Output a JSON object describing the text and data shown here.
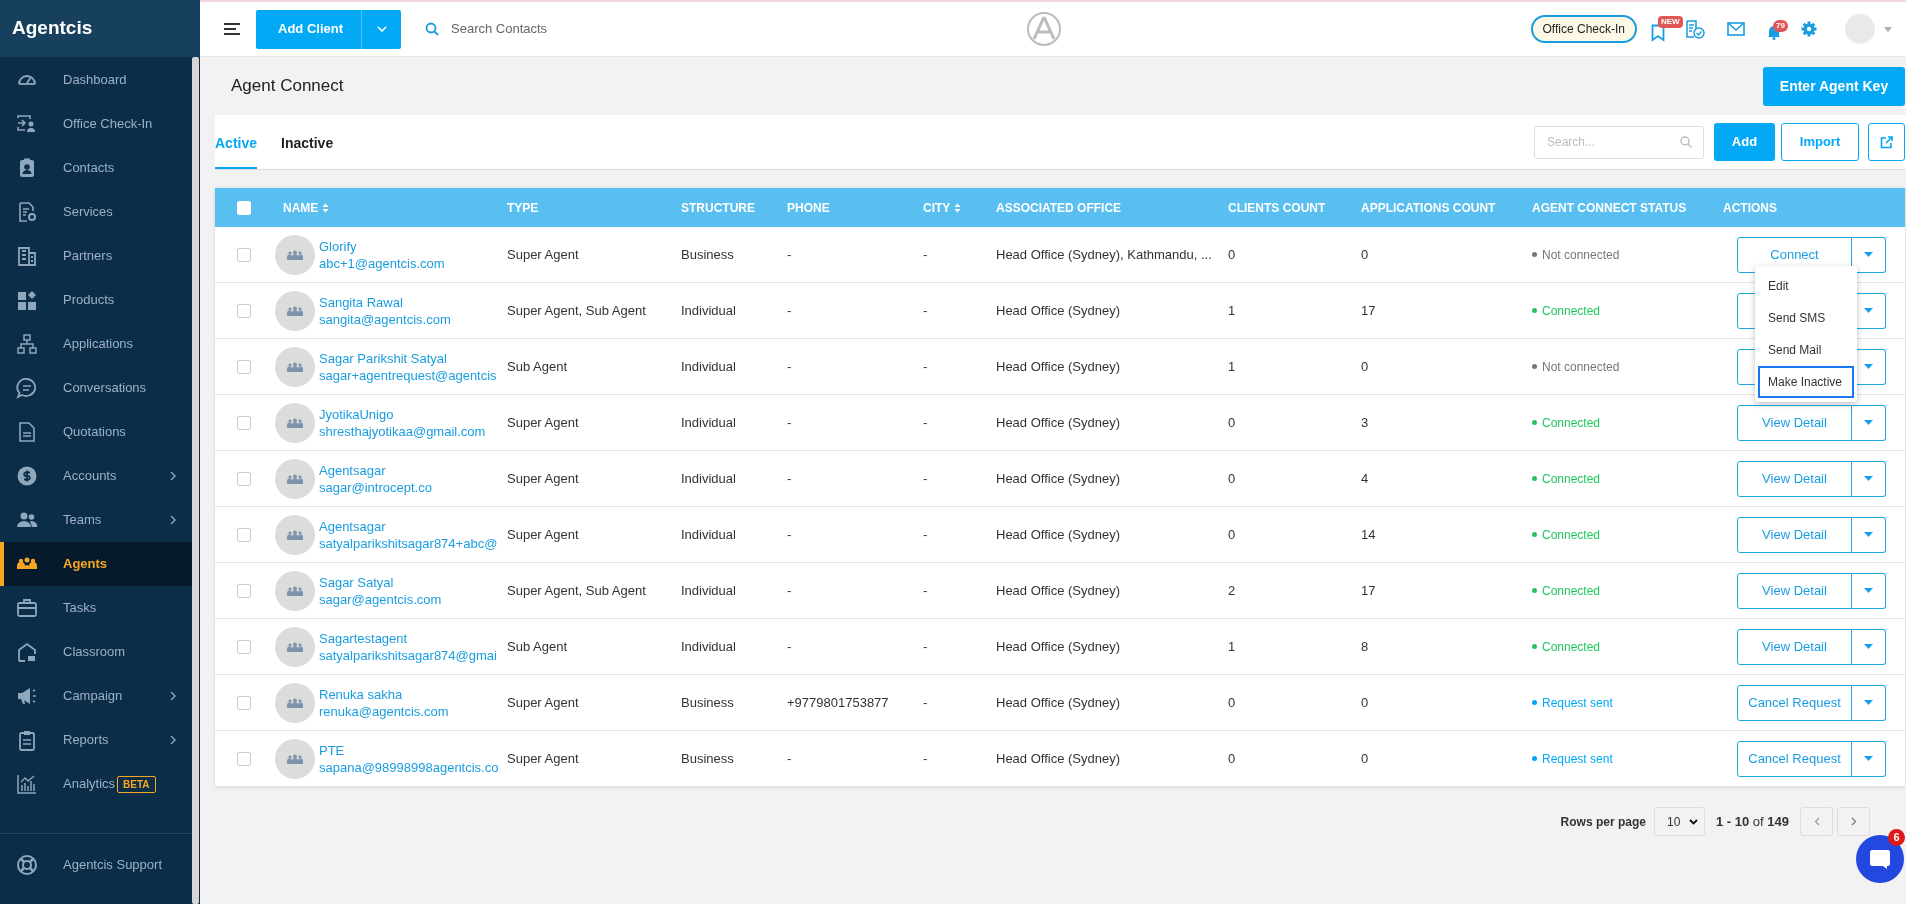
{
  "sidebar": {
    "brand": "Agentcis",
    "items": [
      {
        "label": "Dashboard",
        "submenu": false,
        "selected": false
      },
      {
        "label": "Office Check-In",
        "submenu": false,
        "selected": false
      },
      {
        "label": "Contacts",
        "submenu": false,
        "selected": false
      },
      {
        "label": "Services",
        "submenu": false,
        "selected": false
      },
      {
        "label": "Partners",
        "submenu": false,
        "selected": false
      },
      {
        "label": "Products",
        "submenu": false,
        "selected": false
      },
      {
        "label": "Applications",
        "submenu": false,
        "selected": false
      },
      {
        "label": "Conversations",
        "submenu": false,
        "selected": false
      },
      {
        "label": "Quotations",
        "submenu": false,
        "selected": false
      },
      {
        "label": "Accounts",
        "submenu": true,
        "selected": false
      },
      {
        "label": "Teams",
        "submenu": true,
        "selected": false
      },
      {
        "label": "Agents",
        "submenu": false,
        "selected": true
      },
      {
        "label": "Tasks",
        "submenu": false,
        "selected": false
      },
      {
        "label": "Classroom",
        "submenu": false,
        "selected": false
      },
      {
        "label": "Campaign",
        "submenu": true,
        "selected": false
      },
      {
        "label": "Reports",
        "submenu": true,
        "selected": false
      },
      {
        "label": "Analytics",
        "submenu": false,
        "selected": false,
        "badge": "BETA"
      }
    ],
    "support": "Agentcis Support"
  },
  "topbar": {
    "add_client": "Add Client",
    "search_placeholder": "Search Contacts",
    "office_checkin": "Office Check-In",
    "new_badge": "NEW",
    "notification_count": "79"
  },
  "page": {
    "title": "Agent Connect",
    "enter_key": "Enter Agent Key"
  },
  "tabs": [
    {
      "label": "Active",
      "selected": true
    },
    {
      "label": "Inactive",
      "selected": false
    }
  ],
  "toolbar": {
    "search_placeholder": "Search...",
    "add": "Add",
    "import": "Import"
  },
  "table": {
    "header_checked": false,
    "columns": [
      {
        "label": "NAME",
        "sortable": true
      },
      {
        "label": "TYPE",
        "sortable": false
      },
      {
        "label": "STRUCTURE",
        "sortable": false
      },
      {
        "label": "PHONE",
        "sortable": false
      },
      {
        "label": "CITY",
        "sortable": true
      },
      {
        "label": "ASSOCIATED OFFICE",
        "sortable": false
      },
      {
        "label": "CLIENTS COUNT",
        "sortable": false
      },
      {
        "label": "APPLICATIONS COUNT",
        "sortable": false
      },
      {
        "label": "AGENT CONNECT STATUS",
        "sortable": false
      },
      {
        "label": "ACTIONS",
        "sortable": false
      }
    ],
    "rows": [
      {
        "checked": false,
        "name": "Glorify",
        "email": "abc+1@agentcis.com",
        "type": "Super Agent",
        "structure": "Business",
        "phone": "-",
        "city": "-",
        "office": "Head Office (Sydney), Kathmandu, ...",
        "clients": "0",
        "applications": "0",
        "status": {
          "text": "Not connected",
          "kind": "not_connected"
        },
        "action": "Connect"
      },
      {
        "checked": false,
        "name": "Sangita Rawal",
        "email": "sangita@agentcis.com",
        "type": "Super Agent, Sub Agent",
        "structure": "Individual",
        "phone": "-",
        "city": "-",
        "office": "Head Office (Sydney)",
        "clients": "1",
        "applications": "17",
        "status": {
          "text": "Connected",
          "kind": "connected"
        }
      },
      {
        "checked": false,
        "name": "Sagar Parikshit Satyal",
        "email": "sagar+agentrequest@agentcis",
        "type": "Sub Agent",
        "structure": "Individual",
        "phone": "-",
        "city": "-",
        "office": "Head Office (Sydney)",
        "clients": "1",
        "applications": "0",
        "status": {
          "text": "Not connected",
          "kind": "not_connected"
        }
      },
      {
        "checked": false,
        "name": "JyotikaUnigo",
        "email": "shresthajyotikaa@gmail.com",
        "type": "Super Agent",
        "structure": "Individual",
        "phone": "-",
        "city": "-",
        "office": "Head Office (Sydney)",
        "clients": "0",
        "applications": "3",
        "status": {
          "text": "Connected",
          "kind": "connected"
        },
        "action": "View Detail"
      },
      {
        "checked": false,
        "name": "Agentsagar",
        "email": "sagar@introcept.co",
        "type": "Super Agent",
        "structure": "Individual",
        "phone": "-",
        "city": "-",
        "office": "Head Office (Sydney)",
        "clients": "0",
        "applications": "4",
        "status": {
          "text": "Connected",
          "kind": "connected"
        },
        "action": "View Detail"
      },
      {
        "checked": false,
        "name": "Agentsagar",
        "email": "satyalparikshitsagar874+abc@",
        "type": "Super Agent",
        "structure": "Individual",
        "phone": "-",
        "city": "-",
        "office": "Head Office (Sydney)",
        "clients": "0",
        "applications": "14",
        "status": {
          "text": "Connected",
          "kind": "connected"
        },
        "action": "View Detail"
      },
      {
        "checked": false,
        "name": "Sagar Satyal",
        "email": "sagar@agentcis.com",
        "type": "Super Agent, Sub Agent",
        "structure": "Individual",
        "phone": "-",
        "city": "-",
        "office": "Head Office (Sydney)",
        "clients": "2",
        "applications": "17",
        "status": {
          "text": "Connected",
          "kind": "connected"
        },
        "action": "View Detail"
      },
      {
        "checked": false,
        "name": "Sagartestagent",
        "email": "satyalparikshitsagar874@gmai",
        "type": "Sub Agent",
        "structure": "Individual",
        "phone": "-",
        "city": "-",
        "office": "Head Office (Sydney)",
        "clients": "1",
        "applications": "8",
        "status": {
          "text": "Connected",
          "kind": "connected"
        },
        "action": "View Detail"
      },
      {
        "checked": false,
        "name": "Renuka sakha",
        "email": "renuka@agentcis.com",
        "type": "Super Agent",
        "structure": "Business",
        "phone": "+9779801753877",
        "city": "-",
        "office": "Head Office (Sydney)",
        "clients": "0",
        "applications": "0",
        "status": {
          "text": "Request sent",
          "kind": "request_sent"
        },
        "action": "Cancel Request"
      },
      {
        "checked": false,
        "name": "PTE",
        "email": "sapana@98998998agentcis.co",
        "type": "Super Agent",
        "structure": "Business",
        "phone": "-",
        "city": "-",
        "office": "Head Office (Sydney)",
        "clients": "0",
        "applications": "0",
        "status": {
          "text": "Request sent",
          "kind": "request_sent"
        },
        "action": "Cancel Request"
      }
    ]
  },
  "action_menu": {
    "items": [
      {
        "label": "Edit",
        "selected": false
      },
      {
        "label": "Send SMS",
        "selected": false
      },
      {
        "label": "Send Mail",
        "selected": false
      },
      {
        "label": "Make Inactive",
        "selected": true
      }
    ]
  },
  "pagination": {
    "label": "Rows per page",
    "page_size": "10",
    "range": "**1 - 10** of **149**"
  },
  "chat": {
    "badge": "6"
  }
}
